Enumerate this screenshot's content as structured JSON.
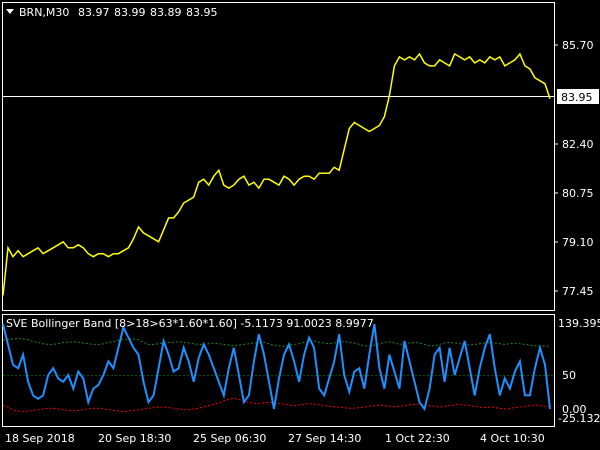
{
  "main_panel": {
    "symbol_label": "BRN,M30",
    "ohlc": [
      "83.97",
      "83.99",
      "83.89",
      "83.95"
    ],
    "price_axis": {
      "ticks": [
        {
          "value": 85.7,
          "label": "85.70"
        },
        {
          "value": 82.4,
          "label": "82.40"
        },
        {
          "value": 80.75,
          "label": "80.75"
        },
        {
          "value": 79.1,
          "label": "79.10"
        },
        {
          "value": 77.45,
          "label": "77.45"
        }
      ],
      "current_price": {
        "value": 83.95,
        "label": "83.95"
      }
    }
  },
  "indicator_panel": {
    "title": "SVE Bollinger Band [8>18>63*1.60*1.60] -5.1173 91.0023 8.9977",
    "axis_ticks": [
      {
        "value": 139.395,
        "label": "139.395"
      },
      {
        "value": 50,
        "label": "50"
      },
      {
        "value": 0,
        "label": "0.00"
      },
      {
        "value": -25.132,
        "label": "-25.132"
      }
    ]
  },
  "time_axis": {
    "labels": [
      "18 Sep 2018",
      "20 Sep 18:30",
      "25 Sep 06:30",
      "27 Sep 14:30",
      "1 Oct 22:30",
      "4 Oct 10:30"
    ]
  },
  "colors": {
    "background": "#000000",
    "price_line": "#ffff00",
    "indicator_line": "#1e90ff",
    "upper_band": "#228b22",
    "lower_band": "#ff0000",
    "mid_band": "#00aa00",
    "grid": "#ffffff"
  },
  "chart_data": {
    "type": "line",
    "series": [
      {
        "name": "BRN,M30",
        "x": [
          0,
          5,
          10,
          15,
          20,
          25,
          30,
          35,
          40,
          45,
          50,
          55,
          60,
          65,
          70,
          75,
          80,
          85,
          90,
          95,
          100,
          105,
          110,
          115,
          120,
          125,
          130,
          135,
          140,
          145,
          150,
          155,
          160,
          165,
          170,
          175,
          180,
          185,
          190,
          195,
          200,
          205,
          210,
          215,
          220,
          225,
          230,
          235,
          240,
          245,
          250,
          255,
          260,
          265,
          270,
          275,
          280,
          285,
          290,
          295,
          300,
          305,
          310,
          315,
          320,
          325,
          330,
          335,
          340,
          345,
          350,
          355,
          360,
          365,
          370,
          375,
          380,
          385,
          390,
          395,
          400,
          405,
          410,
          415,
          420,
          425,
          430,
          435,
          440,
          445,
          450,
          455,
          460,
          465,
          470,
          475,
          480,
          485,
          490,
          495,
          500,
          505,
          510,
          515,
          520,
          525,
          530,
          535,
          540,
          545
        ],
        "values": [
          77.3,
          78.9,
          78.6,
          78.8,
          78.6,
          78.7,
          78.8,
          78.9,
          78.7,
          78.8,
          78.9,
          79.0,
          79.1,
          78.9,
          78.9,
          79.0,
          78.9,
          78.7,
          78.6,
          78.7,
          78.7,
          78.6,
          78.7,
          78.7,
          78.8,
          78.9,
          79.2,
          79.6,
          79.4,
          79.3,
          79.2,
          79.1,
          79.5,
          79.9,
          79.9,
          80.1,
          80.4,
          80.5,
          80.6,
          81.1,
          81.2,
          81.0,
          81.3,
          81.5,
          81.0,
          80.9,
          81.0,
          81.2,
          81.3,
          81.0,
          81.1,
          80.9,
          81.2,
          81.2,
          81.1,
          81.0,
          81.3,
          81.2,
          81.0,
          81.2,
          81.3,
          81.3,
          81.2,
          81.4,
          81.4,
          81.4,
          81.6,
          81.5,
          82.2,
          82.9,
          83.1,
          83.0,
          82.9,
          82.8,
          82.9,
          83.0,
          83.3,
          84.0,
          85.0,
          85.3,
          85.2,
          85.3,
          85.2,
          85.4,
          85.1,
          85.0,
          85.0,
          85.2,
          85.1,
          85.0,
          85.4,
          85.3,
          85.2,
          85.3,
          85.1,
          85.2,
          85.1,
          85.3,
          85.2,
          85.3,
          85.0,
          85.1,
          85.2,
          85.4,
          85.0,
          84.9,
          84.6,
          84.5,
          84.4,
          83.9
        ]
      },
      {
        "name": "SVE Bollinger Band",
        "x": [
          0,
          5,
          10,
          15,
          20,
          25,
          30,
          35,
          40,
          45,
          50,
          55,
          60,
          65,
          70,
          75,
          80,
          85,
          90,
          95,
          100,
          105,
          110,
          115,
          120,
          125,
          130,
          135,
          140,
          145,
          150,
          155,
          160,
          165,
          170,
          175,
          180,
          185,
          190,
          195,
          200,
          205,
          210,
          215,
          220,
          225,
          230,
          235,
          240,
          245,
          250,
          255,
          260,
          265,
          270,
          275,
          280,
          285,
          290,
          295,
          300,
          305,
          310,
          315,
          320,
          325,
          330,
          335,
          340,
          345,
          350,
          355,
          360,
          365,
          370,
          375,
          380,
          385,
          390,
          395,
          400,
          405,
          410,
          415,
          420,
          425,
          430,
          435,
          440,
          445,
          450,
          455,
          460,
          465,
          470,
          475,
          480,
          485,
          490,
          495,
          500,
          505,
          510,
          515,
          520,
          525,
          530,
          535,
          540,
          545
        ],
        "values": [
          125,
          95,
          65,
          60,
          80,
          40,
          20,
          15,
          20,
          50,
          60,
          45,
          40,
          50,
          30,
          55,
          45,
          10,
          30,
          35,
          50,
          70,
          60,
          90,
          120,
          105,
          90,
          80,
          40,
          10,
          20,
          60,
          100,
          80,
          55,
          60,
          90,
          70,
          40,
          75,
          95,
          80,
          60,
          40,
          20,
          60,
          90,
          50,
          10,
          20,
          70,
          110,
          80,
          40,
          0,
          45,
          80,
          95,
          70,
          40,
          80,
          105,
          90,
          30,
          20,
          45,
          70,
          110,
          50,
          25,
          55,
          60,
          30,
          80,
          125,
          60,
          30,
          80,
          55,
          30,
          100,
          70,
          40,
          10,
          0,
          30,
          80,
          90,
          40,
          90,
          50,
          75,
          100,
          60,
          20,
          60,
          90,
          110,
          60,
          20,
          45,
          30,
          55,
          70,
          20,
          20,
          60,
          90,
          65,
          0
        ]
      }
    ],
    "ylim": [
      77.45,
      86.9
    ],
    "indicator_ylim": [
      -25.132,
      139.395
    ],
    "bands": {
      "upper": [
        101,
        102,
        103,
        104,
        103,
        102,
        99,
        98,
        96,
        95,
        95,
        96,
        98,
        98,
        99,
        98,
        97,
        96,
        95,
        95,
        96,
        98,
        99,
        101,
        102,
        103,
        103,
        102,
        98,
        95,
        95,
        96,
        97,
        98,
        98,
        99,
        98,
        97,
        96,
        95,
        95,
        96,
        97,
        96,
        95,
        94,
        93,
        94,
        95,
        96,
        97,
        98,
        98,
        96,
        94,
        93,
        92,
        94,
        95,
        96,
        98,
        99,
        100,
        98,
        97,
        96,
        97,
        98,
        99,
        98,
        97,
        95,
        93,
        92,
        94,
        96,
        98,
        99,
        97,
        95,
        96,
        97,
        98,
        97,
        95,
        93,
        93,
        95,
        97,
        98,
        97,
        96,
        95,
        94,
        95,
        96,
        97,
        98,
        97,
        96,
        95,
        96,
        97,
        96,
        95,
        94,
        93,
        92,
        93,
        92
      ],
      "lower": [
        5,
        3,
        -2,
        -3,
        -4,
        -3,
        -2,
        -1,
        0,
        1,
        1,
        0,
        -1,
        -2,
        -3,
        -2,
        -1,
        0,
        1,
        1,
        0,
        -1,
        -2,
        -3,
        -4,
        -3,
        -2,
        -1,
        0,
        1,
        2,
        3,
        3,
        2,
        1,
        0,
        -1,
        -1,
        0,
        1,
        3,
        5,
        7,
        9,
        12,
        14,
        16,
        14,
        12,
        10,
        8,
        8,
        9,
        10,
        9,
        8,
        7,
        6,
        5,
        6,
        7,
        8,
        7,
        6,
        5,
        4,
        3,
        3,
        2,
        1,
        1,
        2,
        3,
        4,
        5,
        6,
        5,
        4,
        3,
        4,
        5,
        6,
        7,
        7,
        6,
        5,
        4,
        3,
        4,
        5,
        6,
        7,
        6,
        5,
        4,
        3,
        2,
        3,
        2,
        1,
        0,
        1,
        2,
        3,
        4,
        5,
        6,
        5,
        4,
        3
      ]
    }
  }
}
